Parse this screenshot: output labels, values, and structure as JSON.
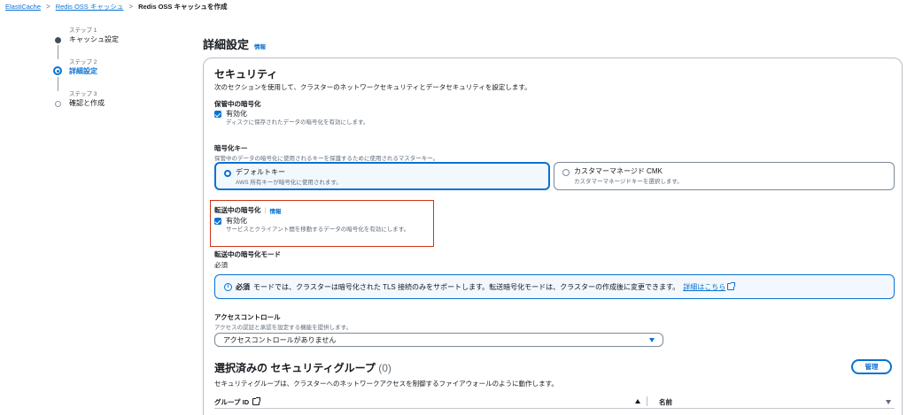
{
  "breadcrumb": {
    "items": [
      "ElastiCache",
      "Redis OSS キャッシュ"
    ],
    "current": "Redis OSS キャッシュを作成"
  },
  "steps": [
    {
      "num": "ステップ 1",
      "label": "キャッシュ設定",
      "state": "done"
    },
    {
      "num": "ステップ 2",
      "label": "詳細設定",
      "state": "active"
    },
    {
      "num": "ステップ 3",
      "label": "確認と作成",
      "state": "pending"
    }
  ],
  "page": {
    "title": "詳細設定",
    "info": "情報"
  },
  "security": {
    "title": "セキュリティ",
    "description": "次のセクションを使用して、クラスターのネットワークセキュリティとデータセキュリティを設定します。",
    "at_rest": {
      "label": "保管中の暗号化",
      "checkbox_label": "有効化",
      "checkbox_desc": "ディスクに保存されたデータの暗号化を有効にします。",
      "checked": true
    },
    "key": {
      "label": "暗号化キー",
      "desc": "保管中のデータの暗号化に使用されるキーを保護するために使用されるマスターキー。",
      "options": [
        {
          "title": "デフォルトキー",
          "desc": "AWS 所有キーが暗号化に使用されます。",
          "selected": true
        },
        {
          "title": "カスタマーマネージド CMK",
          "desc": "カスタマーマネージドキーを選択します。",
          "selected": false
        }
      ]
    },
    "in_transit": {
      "label": "転送中の暗号化",
      "info": "情報",
      "checkbox_label": "有効化",
      "checkbox_desc": "サービスとクライアント間を移動するデータの暗号化を有効にします。",
      "checked": true
    },
    "mode": {
      "label": "転送中の暗号化モード",
      "value": "必須"
    },
    "alert": {
      "bold": "必須",
      "text": " モードでは、クラスターは暗号化された TLS 接続のみをサポートします。転送暗号化モードは、クラスターの作成後に変更できます。",
      "link": "詳細はこちら"
    },
    "access": {
      "label": "アクセスコントロール",
      "desc": "アクセスの認証と承認を設定する機能を提供します。",
      "selected": "アクセスコントロールがありません"
    }
  },
  "security_groups": {
    "title": "選択済みの セキュリティグループ",
    "count": "(0)",
    "desc": "セキュリティグループは、クラスターへのネットワークアクセスを制御するファイアウォールのように動作します。",
    "manage": "管理",
    "columns": [
      "グループ ID",
      "名前"
    ]
  },
  "colors": {
    "accent": "#0972d3",
    "highlight": "#d13212"
  }
}
